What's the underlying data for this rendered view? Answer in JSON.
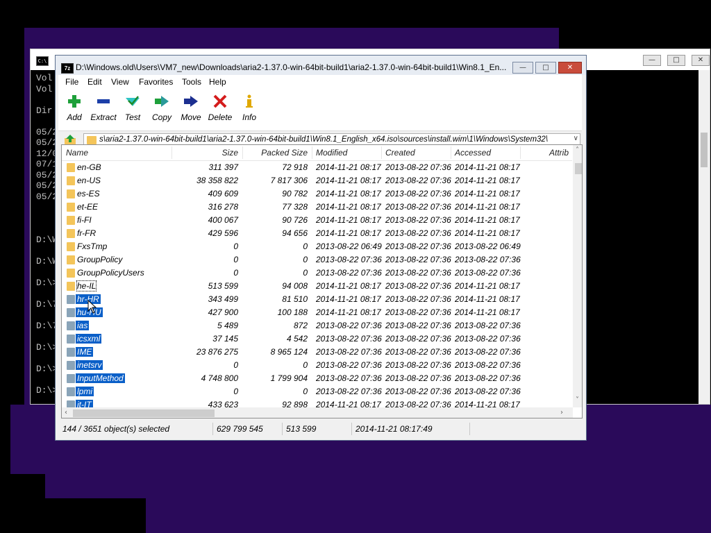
{
  "colors": {
    "desktop": "#2a0a5a",
    "selection": "#0a5fc8",
    "folder": "#f4c55a"
  },
  "console": {
    "icon_text": "C:\\",
    "lines": [
      "Vol",
      "Vol",
      "",
      "Dir",
      "",
      "05/2",
      "05/2",
      "12/0",
      "07/1",
      "05/2",
      "05/2",
      "05/2",
      "",
      "",
      "",
      "D:\\W",
      "",
      "D:\\W",
      "",
      "D:\\>",
      "",
      "D:\\7",
      "",
      "D:\\7",
      "",
      "D:\\>",
      "",
      "D:\\>",
      "",
      "D:\\>"
    ],
    "min_label": "—",
    "max_label": "□",
    "close_label": "✕"
  },
  "window": {
    "icon_text": "7z",
    "title": "D:\\Windows.old\\Users\\VM7_new\\Downloads\\aria2-1.37.0-win-64bit-build1\\aria2-1.37.0-win-64bit-build1\\Win8.1_En...",
    "min_label": "—",
    "max_label": "□",
    "close_label": "✕"
  },
  "menu": [
    "File",
    "Edit",
    "View",
    "Favorites",
    "Tools",
    "Help"
  ],
  "toolbar": [
    {
      "label": "Add",
      "icon": "add-icon"
    },
    {
      "label": "Extract",
      "icon": "extract-icon"
    },
    {
      "label": "Test",
      "icon": "test-icon"
    },
    {
      "label": "Copy",
      "icon": "copy-icon"
    },
    {
      "label": "Move",
      "icon": "move-icon"
    },
    {
      "label": "Delete",
      "icon": "delete-icon"
    },
    {
      "label": "Info",
      "icon": "info-icon"
    }
  ],
  "address": {
    "path": "s\\aria2-1.37.0-win-64bit-build1\\aria2-1.37.0-win-64bit-build1\\Win8.1_English_x64.iso\\sources\\install.wim\\1\\Windows\\System32\\"
  },
  "columns": [
    "Name",
    "Size",
    "Packed Size",
    "Modified",
    "Created",
    "Accessed",
    "Attrib"
  ],
  "rows": [
    {
      "name": "en-GB",
      "size": "311 397",
      "packed": "72 918",
      "modified": "2014-11-21 08:17",
      "created": "2013-08-22 07:36",
      "accessed": "2014-11-21 08:17",
      "selected": false
    },
    {
      "name": "en-US",
      "size": "38 358 822",
      "packed": "7 817 306",
      "modified": "2014-11-21 08:17",
      "created": "2013-08-22 07:36",
      "accessed": "2014-11-21 08:17",
      "selected": false
    },
    {
      "name": "es-ES",
      "size": "409 609",
      "packed": "90 782",
      "modified": "2014-11-21 08:17",
      "created": "2013-08-22 07:36",
      "accessed": "2014-11-21 08:17",
      "selected": false
    },
    {
      "name": "et-EE",
      "size": "316 278",
      "packed": "77 328",
      "modified": "2014-11-21 08:17",
      "created": "2013-08-22 07:36",
      "accessed": "2014-11-21 08:17",
      "selected": false
    },
    {
      "name": "fi-FI",
      "size": "400 067",
      "packed": "90 726",
      "modified": "2014-11-21 08:17",
      "created": "2013-08-22 07:36",
      "accessed": "2014-11-21 08:17",
      "selected": false
    },
    {
      "name": "fr-FR",
      "size": "429 596",
      "packed": "94 656",
      "modified": "2014-11-21 08:17",
      "created": "2013-08-22 07:36",
      "accessed": "2014-11-21 08:17",
      "selected": false
    },
    {
      "name": "FxsTmp",
      "size": "0",
      "packed": "0",
      "modified": "2013-08-22 06:49",
      "created": "2013-08-22 07:36",
      "accessed": "2013-08-22 06:49",
      "selected": false
    },
    {
      "name": "GroupPolicy",
      "size": "0",
      "packed": "0",
      "modified": "2013-08-22 07:36",
      "created": "2013-08-22 07:36",
      "accessed": "2013-08-22 07:36",
      "selected": false
    },
    {
      "name": "GroupPolicyUsers",
      "size": "0",
      "packed": "0",
      "modified": "2013-08-22 07:36",
      "created": "2013-08-22 07:36",
      "accessed": "2013-08-22 07:36",
      "selected": false
    },
    {
      "name": "he-IL",
      "size": "513 599",
      "packed": "94 008",
      "modified": "2014-11-21 08:17",
      "created": "2013-08-22 07:36",
      "accessed": "2014-11-21 08:17",
      "selected": false,
      "focus": true
    },
    {
      "name": "hr-HR",
      "size": "343 499",
      "packed": "81 510",
      "modified": "2014-11-21 08:17",
      "created": "2013-08-22 07:36",
      "accessed": "2014-11-21 08:17",
      "selected": true
    },
    {
      "name": "hu-HU",
      "size": "427 900",
      "packed": "100 188",
      "modified": "2014-11-21 08:17",
      "created": "2013-08-22 07:36",
      "accessed": "2014-11-21 08:17",
      "selected": true
    },
    {
      "name": "ias",
      "size": "5 489",
      "packed": "872",
      "modified": "2013-08-22 07:36",
      "created": "2013-08-22 07:36",
      "accessed": "2013-08-22 07:36",
      "selected": true
    },
    {
      "name": "icsxml",
      "size": "37 145",
      "packed": "4 542",
      "modified": "2013-08-22 07:36",
      "created": "2013-08-22 07:36",
      "accessed": "2013-08-22 07:36",
      "selected": true
    },
    {
      "name": "IME",
      "size": "23 876 275",
      "packed": "8 965 124",
      "modified": "2013-08-22 07:36",
      "created": "2013-08-22 07:36",
      "accessed": "2013-08-22 07:36",
      "selected": true
    },
    {
      "name": "inetsrv",
      "size": "0",
      "packed": "0",
      "modified": "2013-08-22 07:36",
      "created": "2013-08-22 07:36",
      "accessed": "2013-08-22 07:36",
      "selected": true
    },
    {
      "name": "InputMethod",
      "size": "4 748 800",
      "packed": "1 799 904",
      "modified": "2013-08-22 07:36",
      "created": "2013-08-22 07:36",
      "accessed": "2013-08-22 07:36",
      "selected": true
    },
    {
      "name": "lpmi",
      "size": "0",
      "packed": "0",
      "modified": "2013-08-22 07:36",
      "created": "2013-08-22 07:36",
      "accessed": "2013-08-22 07:36",
      "selected": true
    },
    {
      "name": "it-IT",
      "size": "433 623",
      "packed": "92 898",
      "modified": "2014-11-21 08:17",
      "created": "2013-08-22 07:36",
      "accessed": "2014-11-21 08:17",
      "selected": true
    }
  ],
  "status": {
    "selected": "144 / 3651 object(s) selected",
    "total_size": "629 799 545",
    "item_size": "513 599",
    "item_date": "2014-11-21 08:17:49"
  }
}
